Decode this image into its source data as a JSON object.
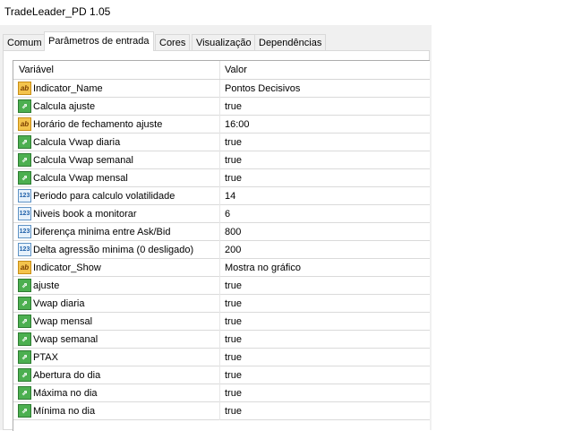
{
  "window": {
    "title": "TradeLeader_PD 1.05"
  },
  "tabs": [
    {
      "label": "Comum"
    },
    {
      "label": "Parâmetros de entrada"
    },
    {
      "label": "Cores"
    },
    {
      "label": "Visualização"
    },
    {
      "label": "Dependências"
    }
  ],
  "grid": {
    "header": {
      "variable": "Variável",
      "value": "Valor"
    },
    "rows": [
      {
        "icon": "text-param-icon",
        "name": "Indicator_Name",
        "value": "Pontos Decisivos"
      },
      {
        "icon": "bool-param-icon",
        "name": "Calcula ajuste",
        "value": "true"
      },
      {
        "icon": "text-param-icon",
        "name": "Horário de fechamento ajuste",
        "value": "16:00"
      },
      {
        "icon": "bool-param-icon",
        "name": "Calcula Vwap diaria",
        "value": "true"
      },
      {
        "icon": "bool-param-icon",
        "name": "Calcula Vwap semanal",
        "value": "true"
      },
      {
        "icon": "bool-param-icon",
        "name": "Calcula Vwap mensal",
        "value": "true"
      },
      {
        "icon": "number-param-icon",
        "name": "Periodo para calculo volatilidade",
        "value": "14"
      },
      {
        "icon": "number-param-icon",
        "name": "Niveis book a monitorar",
        "value": "6"
      },
      {
        "icon": "number-param-icon",
        "name": "Diferença minima entre Ask/Bid",
        "value": "800"
      },
      {
        "icon": "number-param-icon",
        "name": "Delta agressão minima (0 desligado)",
        "value": "200"
      },
      {
        "icon": "text-param-icon",
        "name": "Indicator_Show",
        "value": "Mostra no gráfico"
      },
      {
        "icon": "bool-param-icon",
        "name": "ajuste",
        "value": "true"
      },
      {
        "icon": "bool-param-icon",
        "name": "Vwap diaria",
        "value": "true"
      },
      {
        "icon": "bool-param-icon",
        "name": "Vwap mensal",
        "value": "true"
      },
      {
        "icon": "bool-param-icon",
        "name": "Vwap semanal",
        "value": "true"
      },
      {
        "icon": "bool-param-icon",
        "name": "PTAX",
        "value": "true"
      },
      {
        "icon": "bool-param-icon",
        "name": "Abertura do dia",
        "value": "true"
      },
      {
        "icon": "bool-param-icon",
        "name": "Máxima no dia",
        "value": "true"
      },
      {
        "icon": "bool-param-icon",
        "name": "Mínima no dia",
        "value": "true"
      }
    ]
  }
}
